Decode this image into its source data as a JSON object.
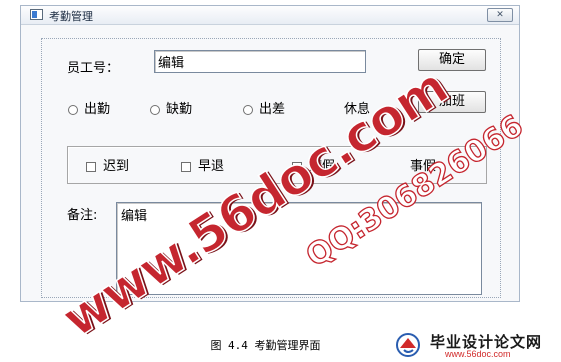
{
  "window": {
    "title": "考勤管理",
    "close_glyph": "✕"
  },
  "form": {
    "employee_label": "员工号：",
    "employee_value": "编辑",
    "confirm_label": "确定",
    "overtime_label": "加班",
    "attendance_options": [
      "出勤",
      "缺勤",
      "出差",
      "休息"
    ],
    "checkbox_options": [
      "迟到",
      "早退",
      "病假",
      "事假"
    ],
    "notes_label": "备注:",
    "notes_value": "编辑"
  },
  "watermark": {
    "site": "www.56doc.com",
    "qq": "QQ:306826066"
  },
  "caption": "图 4.4 考勤管理界面",
  "brand": {
    "name": "毕业设计论文网",
    "url": "www.56doc.com"
  },
  "colors": {
    "accent_red": "#c5262f",
    "window_border": "#a9b7c9"
  },
  "icons": {
    "app": "window-app-icon",
    "close": "close-icon",
    "logo": "brand-logo-icon"
  }
}
